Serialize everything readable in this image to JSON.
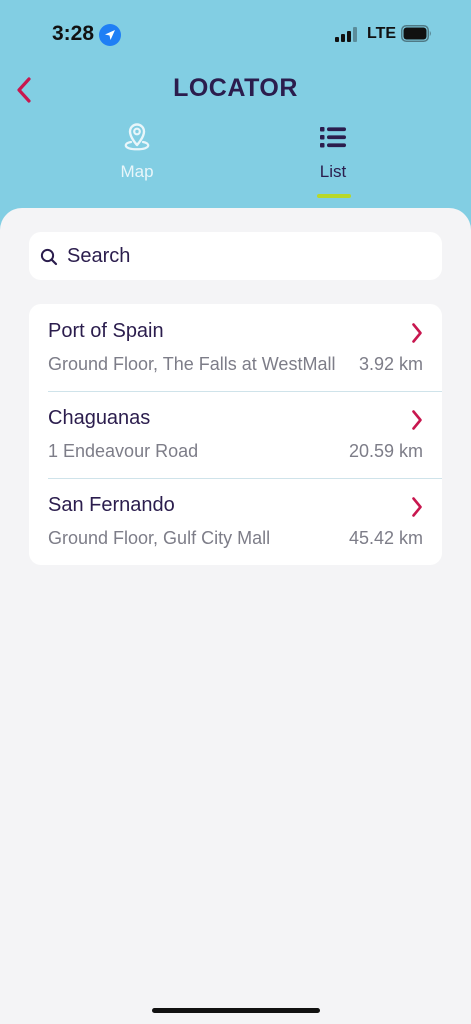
{
  "status_bar": {
    "time": "3:28",
    "network": "LTE"
  },
  "header": {
    "title": "LOCATOR",
    "back_icon": "chevron-left-icon"
  },
  "tabs": [
    {
      "label": "Map",
      "icon": "map-pin-icon",
      "selected": false
    },
    {
      "label": "List",
      "icon": "list-icon",
      "selected": true
    }
  ],
  "search": {
    "placeholder": "Search",
    "value": ""
  },
  "locations": [
    {
      "name": "Port of Spain",
      "address": "Ground Floor, The Falls at WestMall",
      "distance": "3.92 km"
    },
    {
      "name": "Chaguanas",
      "address": "1 Endeavour Road",
      "distance": "20.59 km"
    },
    {
      "name": "San Fernando",
      "address": "Ground Floor, Gulf City Mall",
      "distance": "45.42 km"
    }
  ],
  "colors": {
    "header_bg": "#82cee3",
    "title": "#2b1d4d",
    "accent_red": "#c8174f",
    "tab_indicator": "#b8d82a",
    "background": "#f4f4f6"
  }
}
